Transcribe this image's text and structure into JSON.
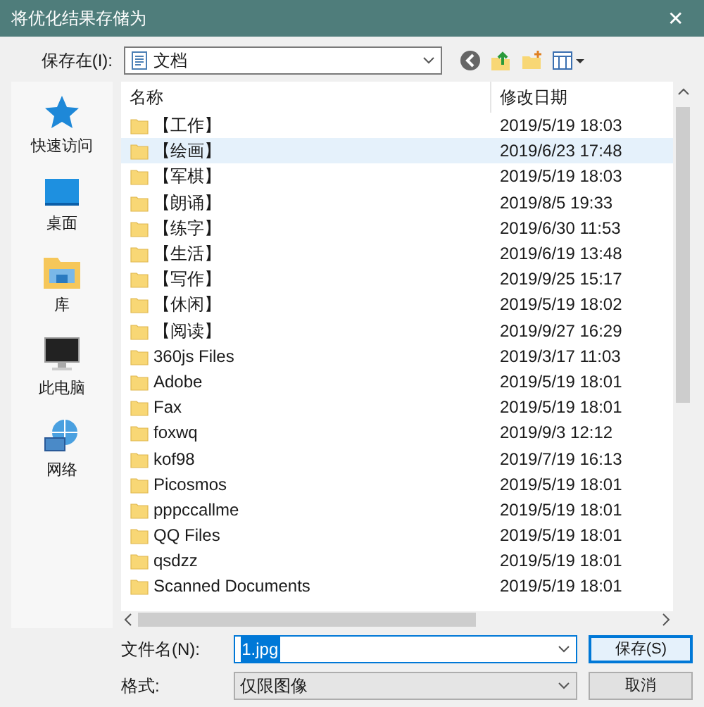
{
  "window": {
    "title": "将优化结果存储为",
    "close": "✕"
  },
  "location": {
    "label": "保存在(I):",
    "value": "文档"
  },
  "sidebar": {
    "items": [
      {
        "label": "快速访问",
        "kind": "star"
      },
      {
        "label": "桌面",
        "kind": "desktop"
      },
      {
        "label": "库",
        "kind": "library"
      },
      {
        "label": "此电脑",
        "kind": "computer"
      },
      {
        "label": "网络",
        "kind": "network"
      }
    ]
  },
  "table": {
    "columns": [
      "名称",
      "修改日期"
    ],
    "rows": [
      {
        "name": "【工作】",
        "date": "2019/5/19 18:03",
        "selected": false
      },
      {
        "name": "【绘画】",
        "date": "2019/6/23 17:48",
        "selected": true
      },
      {
        "name": "【军棋】",
        "date": "2019/5/19 18:03",
        "selected": false
      },
      {
        "name": "【朗诵】",
        "date": "2019/8/5 19:33",
        "selected": false
      },
      {
        "name": "【练字】",
        "date": "2019/6/30 11:53",
        "selected": false
      },
      {
        "name": "【生活】",
        "date": "2019/6/19 13:48",
        "selected": false
      },
      {
        "name": "【写作】",
        "date": "2019/9/25 15:17",
        "selected": false
      },
      {
        "name": "【休闲】",
        "date": "2019/5/19 18:02",
        "selected": false
      },
      {
        "name": "【阅读】",
        "date": "2019/9/27 16:29",
        "selected": false
      },
      {
        "name": "360js Files",
        "date": "2019/3/17 11:03",
        "selected": false
      },
      {
        "name": "Adobe",
        "date": "2019/5/19 18:01",
        "selected": false
      },
      {
        "name": "Fax",
        "date": "2019/5/19 18:01",
        "selected": false
      },
      {
        "name": "foxwq",
        "date": "2019/9/3 12:12",
        "selected": false
      },
      {
        "name": "kof98",
        "date": "2019/7/19 16:13",
        "selected": false
      },
      {
        "name": "Picosmos",
        "date": "2019/5/19 18:01",
        "selected": false
      },
      {
        "name": "pppccallme",
        "date": "2019/5/19 18:01",
        "selected": false
      },
      {
        "name": "QQ Files",
        "date": "2019/5/19 18:01",
        "selected": false
      },
      {
        "name": "qsdzz",
        "date": "2019/5/19 18:01",
        "selected": false
      },
      {
        "name": "Scanned Documents",
        "date": "2019/5/19 18:01",
        "selected": false
      }
    ]
  },
  "filename": {
    "label": "文件名(N):",
    "value": "1.jpg"
  },
  "format": {
    "label": "格式:",
    "value": "仅限图像"
  },
  "buttons": [
    "保存(S)",
    "取消"
  ]
}
